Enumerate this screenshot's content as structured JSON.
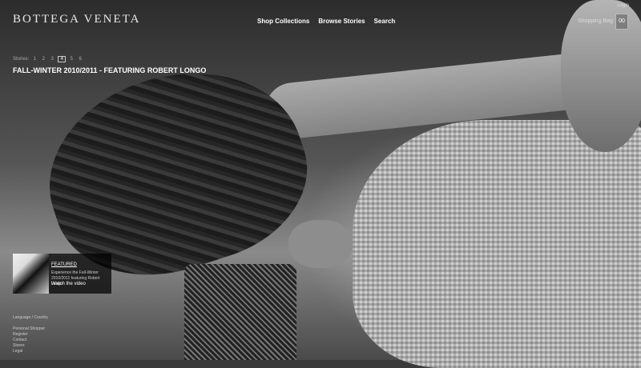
{
  "brand": "BOTTEGA VENETA",
  "nav": [
    {
      "label": "Shop Collections"
    },
    {
      "label": "Browse Stories"
    },
    {
      "label": "Search"
    }
  ],
  "account": {
    "login": "Login",
    "shopping_bag": "Shopping Bag",
    "bag_count": "00"
  },
  "stories": {
    "label": "Stories:",
    "numbers": [
      "1",
      "2",
      "3",
      "4",
      "5",
      "6"
    ],
    "active": "4"
  },
  "headline": "FALL-WINTER 2010/2011 - FEATURING ROBERT LONGO",
  "featured": {
    "title": "FEATURED",
    "description": "Experience the Fall-Winter 2010/2011 featuring Robert Longo",
    "link": "Watch the video"
  },
  "footer": {
    "language": "Language / Country",
    "links": [
      "Personal Shopper",
      "Register",
      "Contact",
      "Stores",
      "Legal"
    ]
  }
}
